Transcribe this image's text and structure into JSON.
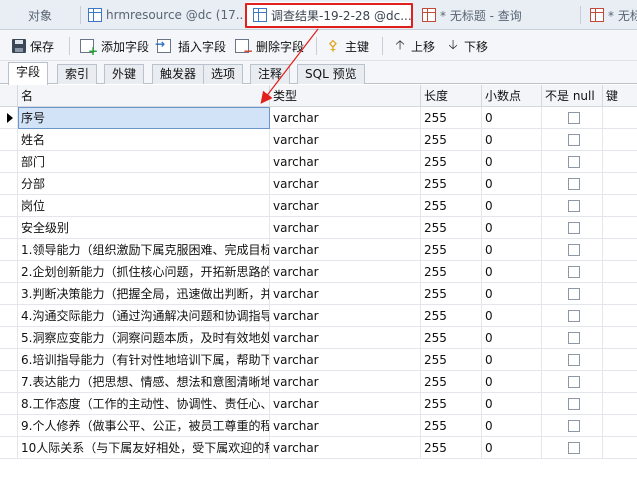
{
  "doc_tabs": [
    {
      "label": "对象",
      "icon": "none"
    },
    {
      "label": "hrmresource @dc (17...",
      "icon": "table-icon"
    },
    {
      "label": "调查结果-19-2-28 @dc...",
      "icon": "table-icon"
    },
    {
      "label": "* 无标题 - 查询",
      "icon": "query-icon"
    },
    {
      "label": "* 无标",
      "icon": "query-icon"
    }
  ],
  "toolbar": {
    "save": "保存",
    "add_field": "添加字段",
    "insert_field": "插入字段",
    "delete_field": "删除字段",
    "primary_key": "主键",
    "move_up": "上移",
    "move_down": "下移"
  },
  "sub_tabs": [
    "字段",
    "索引",
    "外键",
    "触发器",
    "选项",
    "注释",
    "SQL 预览"
  ],
  "columns": {
    "name": "名",
    "type": "类型",
    "length": "长度",
    "decimals": "小数点",
    "not_null": "不是 null",
    "key": "键"
  },
  "rows": [
    {
      "name": "序号",
      "type": "varchar",
      "length": "255",
      "decimals": "0",
      "selected": true
    },
    {
      "name": "姓名",
      "type": "varchar",
      "length": "255",
      "decimals": "0"
    },
    {
      "name": "部门",
      "type": "varchar",
      "length": "255",
      "decimals": "0"
    },
    {
      "name": "分部",
      "type": "varchar",
      "length": "255",
      "decimals": "0"
    },
    {
      "name": "岗位",
      "type": "varchar",
      "length": "255",
      "decimals": "0"
    },
    {
      "name": "安全级别",
      "type": "varchar",
      "length": "255",
      "decimals": "0"
    },
    {
      "name": "1.领导能力（组织激励下属克服困难、完成目标",
      "type": "varchar",
      "length": "255",
      "decimals": "0"
    },
    {
      "name": "2.企划创新能力（抓住核心问题，开拓新思路的",
      "type": "varchar",
      "length": "255",
      "decimals": "0"
    },
    {
      "name": "3.判断决策能力（把握全局，迅速做出判断，并",
      "type": "varchar",
      "length": "255",
      "decimals": "0"
    },
    {
      "name": "4.沟通交际能力（通过沟通解决问题和协调指导",
      "type": "varchar",
      "length": "255",
      "decimals": "0"
    },
    {
      "name": "5.洞察应变能力（洞察问题本质，及时有效地处",
      "type": "varchar",
      "length": "255",
      "decimals": "0"
    },
    {
      "name": "6.培训指导能力（有针对性地培训下属，帮助下",
      "type": "varchar",
      "length": "255",
      "decimals": "0"
    },
    {
      "name": "7.表达能力（把思想、情感、想法和意图清晰地",
      "type": "varchar",
      "length": "255",
      "decimals": "0"
    },
    {
      "name": "8.工作态度（工作的主动性、协调性、责任心、",
      "type": "varchar",
      "length": "255",
      "decimals": "0"
    },
    {
      "name": "9.个人修养（做事公平、公正，被员工尊重的程",
      "type": "varchar",
      "length": "255",
      "decimals": "0"
    },
    {
      "name": "10人际关系（与下属友好相处，受下属欢迎的程",
      "type": "varchar",
      "length": "255",
      "decimals": "0"
    }
  ],
  "colors": {
    "highlight_box": "#e0201c",
    "selected_cell": "#d3e3f7"
  }
}
